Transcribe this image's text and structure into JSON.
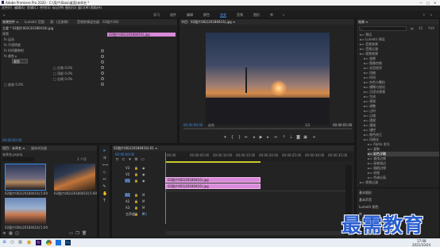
{
  "app": {
    "title": "Adobe Premiere Pro 2020 - C:\\用户\\Sbox\\桌面\\未命名 *",
    "menus": [
      "文件(F)",
      "编辑(E)",
      "剪辑(C)",
      "序列(S)",
      "标记(M)",
      "图形(G)",
      "窗口(W)",
      "帮助(H)"
    ],
    "workspaces": [
      "学习",
      "组件",
      "编辑",
      "颜色",
      "效果",
      "音频",
      "图形",
      "库"
    ],
    "active_workspace": "效果"
  },
  "effect_controls": {
    "tabs": [
      "效果控件 ≡",
      "Lumetri 范围",
      "源：(无剪辑)",
      "音频剪辑混合器：02图片002"
    ],
    "source_label": "主要 * 02图片002(20180416).jpg",
    "clip_label": "02图片002(20180416).jpg",
    "section_video": "视频",
    "rows": [
      "fx 运动",
      "fx 不透明度",
      "fx 时间重映射",
      "fx 裁剪 ▸",
      "裁剪",
      "□ 左侧 0.0%",
      "□ 顶部 0.0%",
      "□ 右侧 0.0%",
      "□ 底部 0.0%",
      "羽化边缘",
      "○ 缩放",
      "○ 0.0",
      "○ 0.0"
    ],
    "timecode": "00:00:00:00"
  },
  "program_monitor": {
    "tab": "节目：02图片002(20180416).jpg ≡",
    "timecode_left": "00:00:00:00",
    "fit_label": "适合",
    "quality_label": "1/2",
    "timecode_right": "00:00:05:00"
  },
  "project": {
    "tabs": [
      "项目：未命名 ≡",
      "媒体浏览器"
    ],
    "name": "未命名.prproj",
    "item_count": "3 个项",
    "items": [
      {
        "name": "02图片002(20180416).jpg",
        "dur": "5:00"
      },
      {
        "name": "02图片002(20180416).jpg",
        "dur": "5:00"
      },
      {
        "name": "02图片004(20180416).jpg",
        "dur": "5:00"
      }
    ]
  },
  "timeline": {
    "tab": "02图片002(20180416)-01 ≡",
    "timecode": "00:00:00:00",
    "ruler": [
      "00:00",
      "00:00:05:00",
      "00:00:10:00",
      "00:00:15:00",
      "00:00:20:00",
      "00:00:25:00",
      "00:00:30:00",
      "00:00:35:00"
    ],
    "tracks": [
      "V3",
      "V2",
      "V1",
      "A1",
      "A2",
      "A3",
      "主声道"
    ],
    "master_value": "0.0",
    "clips": [
      "02图片002(20180416).jpg",
      "02图片001(20180416).jpg"
    ]
  },
  "effects": {
    "tab": "效果 ≡",
    "search_placeholder": "",
    "tree": [
      "预设",
      "Lumetri 预设",
      "音频效果",
      "音频过渡",
      "视频效果",
      "变换",
      "图像控制",
      "实用程序",
      "扭曲",
      "时间",
      "杂色与颗粒",
      "模糊与锐化",
      "沉浸式视频",
      "生成",
      "视频",
      "调整",
      "过时",
      "过渡",
      "透视",
      "通道",
      "键控",
      "颜色校正",
      "风格化",
      "Alpha 发光",
      "复制",
      "彩色浮雕",
      "查找边缘",
      "画笔描边",
      "粗糙边缘",
      "纹理",
      "色调分离",
      "视频过渡"
    ],
    "selected_index": 25,
    "bottom_tabs": [
      "基本图形",
      "基本声音",
      "Lumetri 颜色",
      "库",
      "标记"
    ]
  },
  "watermark": "最需教育",
  "taskbar": {
    "time": "17:08",
    "date": "2021/10/24",
    "apps": [
      "windows-icon",
      "search-icon",
      "taskview-icon",
      "explorer-icon",
      "premiere-icon",
      "chrome-icon",
      "photos-icon",
      "photoshop-icon"
    ]
  }
}
